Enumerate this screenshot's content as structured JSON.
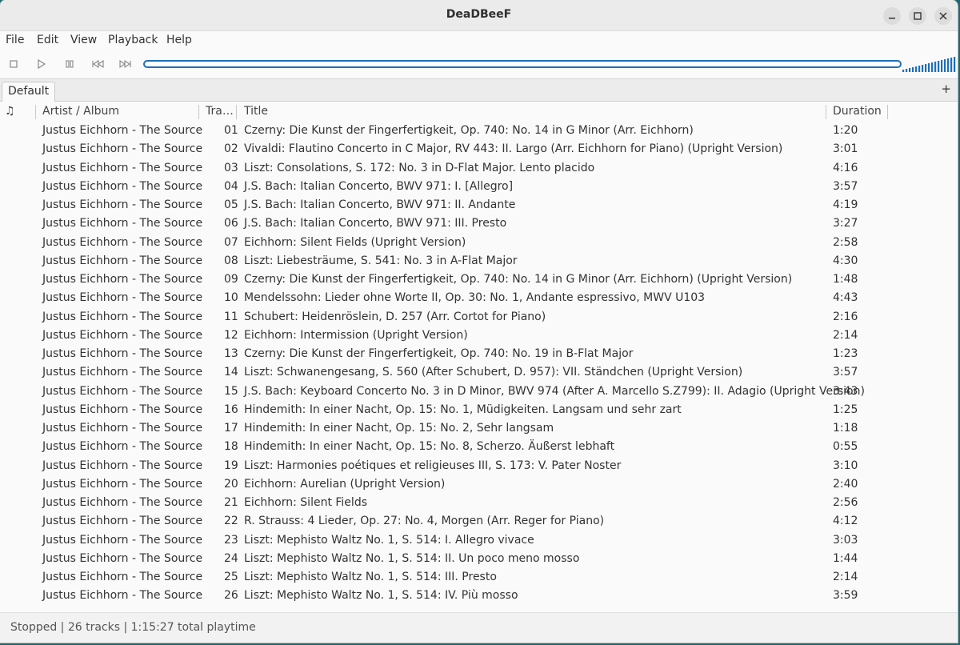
{
  "window": {
    "title": "DeaDBeeF"
  },
  "menu": [
    "File",
    "Edit",
    "View",
    "Playback",
    "Help"
  ],
  "playlist_tabs": [
    {
      "label": "Default"
    }
  ],
  "tab_add_label": "+",
  "columns": {
    "playing": "♫",
    "artist": "Artist / Album",
    "track": "Tra…",
    "title": "Title",
    "duration": "Duration"
  },
  "seekbar": {
    "position": 0
  },
  "volume": {
    "level": 1.0
  },
  "tracks": [
    {
      "artist": "Justus Eichhorn - The Source",
      "track": "01",
      "title": "Czerny: Die Kunst der Fingerfertigkeit, Op. 740: No. 14 in G Minor (Arr. Eichhorn)",
      "duration": "1:20"
    },
    {
      "artist": "Justus Eichhorn - The Source",
      "track": "02",
      "title": "Vivaldi: Flautino Concerto in C Major, RV 443: II. Largo (Arr. Eichhorn for Piano) (Upright Version)",
      "duration": "3:01"
    },
    {
      "artist": "Justus Eichhorn - The Source",
      "track": "03",
      "title": "Liszt: Consolations, S. 172: No. 3 in D-Flat Major. Lento placido",
      "duration": "4:16"
    },
    {
      "artist": "Justus Eichhorn - The Source",
      "track": "04",
      "title": "J.S. Bach: Italian Concerto, BWV 971: I. [Allegro]",
      "duration": "3:57"
    },
    {
      "artist": "Justus Eichhorn - The Source",
      "track": "05",
      "title": "J.S. Bach: Italian Concerto, BWV 971: II. Andante",
      "duration": "4:19"
    },
    {
      "artist": "Justus Eichhorn - The Source",
      "track": "06",
      "title": "J.S. Bach: Italian Concerto, BWV 971: III. Presto",
      "duration": "3:27"
    },
    {
      "artist": "Justus Eichhorn - The Source",
      "track": "07",
      "title": "Eichhorn: Silent Fields (Upright Version)",
      "duration": "2:58"
    },
    {
      "artist": "Justus Eichhorn - The Source",
      "track": "08",
      "title": "Liszt: Liebesträume, S. 541: No. 3 in A-Flat Major",
      "duration": "4:30"
    },
    {
      "artist": "Justus Eichhorn - The Source",
      "track": "09",
      "title": "Czerny: Die Kunst der Fingerfertigkeit, Op. 740: No. 14 in G Minor (Arr. Eichhorn) (Upright Version)",
      "duration": "1:48"
    },
    {
      "artist": "Justus Eichhorn - The Source",
      "track": "10",
      "title": "Mendelssohn: Lieder ohne Worte II, Op. 30: No. 1, Andante espressivo, MWV U103",
      "duration": "4:43"
    },
    {
      "artist": "Justus Eichhorn - The Source",
      "track": "11",
      "title": "Schubert: Heidenröslein, D. 257 (Arr. Cortot for Piano)",
      "duration": "2:16"
    },
    {
      "artist": "Justus Eichhorn - The Source",
      "track": "12",
      "title": "Eichhorn: Intermission (Upright Version)",
      "duration": "2:14"
    },
    {
      "artist": "Justus Eichhorn - The Source",
      "track": "13",
      "title": "Czerny: Die Kunst der Fingerfertigkeit, Op. 740: No. 19 in B-Flat Major",
      "duration": "1:23"
    },
    {
      "artist": "Justus Eichhorn - The Source",
      "track": "14",
      "title": "Liszt: Schwanengesang, S. 560 (After Schubert, D. 957): VII. Ständchen (Upright Version)",
      "duration": "3:57"
    },
    {
      "artist": "Justus Eichhorn - The Source",
      "track": "15",
      "title": "J.S. Bach: Keyboard Concerto No. 3 in D Minor, BWV 974 (After A. Marcello S.Z799): II. Adagio (Upright Version)",
      "duration": "3:43"
    },
    {
      "artist": "Justus Eichhorn - The Source",
      "track": "16",
      "title": "Hindemith: In einer Nacht, Op. 15: No. 1, Müdigkeiten. Langsam und sehr zart",
      "duration": "1:25"
    },
    {
      "artist": "Justus Eichhorn - The Source",
      "track": "17",
      "title": "Hindemith: In einer Nacht, Op. 15: No. 2, Sehr langsam",
      "duration": "1:18"
    },
    {
      "artist": "Justus Eichhorn - The Source",
      "track": "18",
      "title": "Hindemith: In einer Nacht, Op. 15: No. 8, Scherzo. Äußerst lebhaft",
      "duration": "0:55"
    },
    {
      "artist": "Justus Eichhorn - The Source",
      "track": "19",
      "title": "Liszt: Harmonies poétiques et religieuses III, S. 173: V. Pater Noster",
      "duration": "3:10"
    },
    {
      "artist": "Justus Eichhorn - The Source",
      "track": "20",
      "title": "Eichhorn: Aurelian (Upright Version)",
      "duration": "2:40"
    },
    {
      "artist": "Justus Eichhorn - The Source",
      "track": "21",
      "title": "Eichhorn: Silent Fields",
      "duration": "2:56"
    },
    {
      "artist": "Justus Eichhorn - The Source",
      "track": "22",
      "title": "R. Strauss: 4 Lieder, Op. 27: No. 4, Morgen (Arr. Reger for Piano)",
      "duration": "4:12"
    },
    {
      "artist": "Justus Eichhorn - The Source",
      "track": "23",
      "title": "Liszt: Mephisto Waltz No. 1, S. 514: I. Allegro vivace",
      "duration": "3:03"
    },
    {
      "artist": "Justus Eichhorn - The Source",
      "track": "24",
      "title": "Liszt: Mephisto Waltz No. 1, S. 514: II. Un poco meno mosso",
      "duration": "1:44"
    },
    {
      "artist": "Justus Eichhorn - The Source",
      "track": "25",
      "title": "Liszt: Mephisto Waltz No. 1, S. 514: III. Presto",
      "duration": "2:14"
    },
    {
      "artist": "Justus Eichhorn - The Source",
      "track": "26",
      "title": "Liszt: Mephisto Waltz No. 1, S. 514: IV. Più mosso",
      "duration": "3:59"
    }
  ],
  "status": "Stopped | 26 tracks | 1:15:27 total playtime",
  "colors": {
    "accent": "#1e6fba",
    "titlebar": "#ebebeb",
    "background": "#fafafa"
  }
}
